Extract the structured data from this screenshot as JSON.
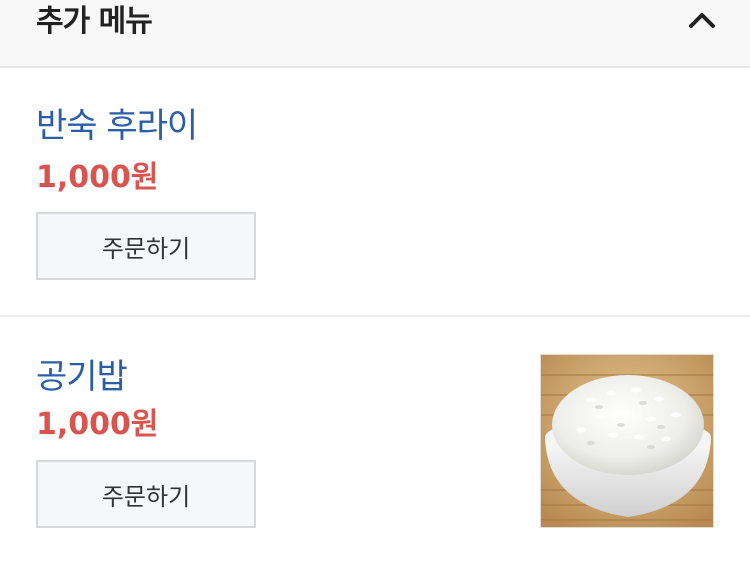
{
  "section": {
    "title": "추가 메뉴",
    "toggle_icon": "chevron-up-icon"
  },
  "items": [
    {
      "name": "반숙 후라이",
      "price": "1,000원",
      "button_label": "주문하기",
      "has_image": false
    },
    {
      "name": "공기밥",
      "price": "1,000원",
      "button_label": "주문하기",
      "has_image": true,
      "image_icon": "rice-bowl-photo"
    }
  ],
  "colors": {
    "item_name": "#2a5ea8",
    "price": "#d9534f",
    "header_bg": "#f8f8f9"
  }
}
